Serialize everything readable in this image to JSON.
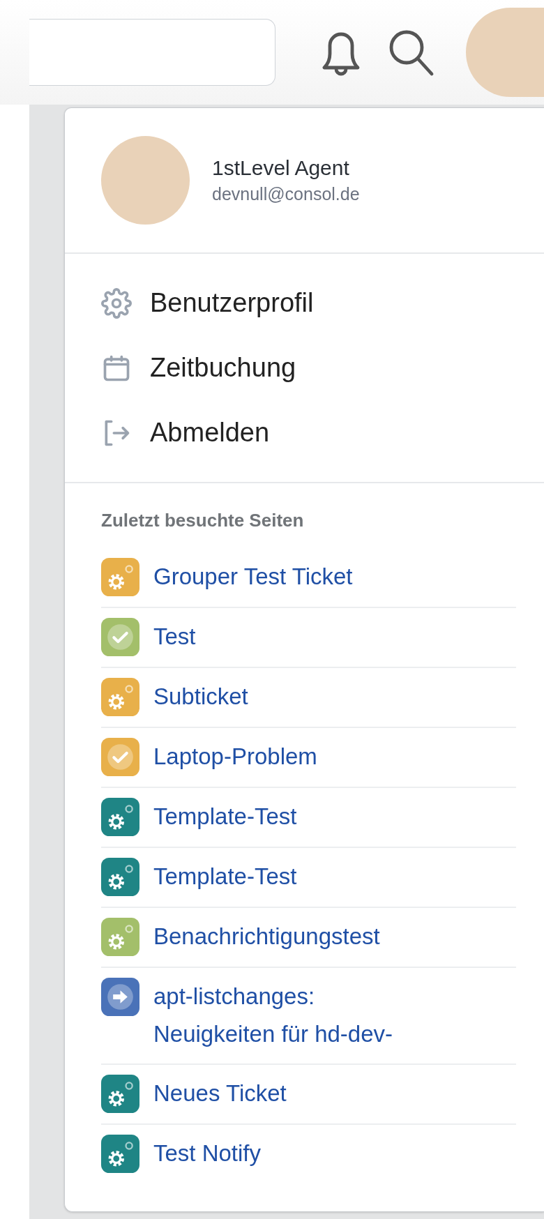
{
  "user": {
    "name": "1stLevel Agent",
    "email": "devnull@consol.de"
  },
  "menu": [
    {
      "label": "Benutzerprofil",
      "kind": "settings"
    },
    {
      "label": "Zeitbuchung",
      "kind": "calendar"
    },
    {
      "label": "Abmelden",
      "kind": "logout"
    }
  ],
  "recent": {
    "title": "Zuletzt besuchte Seiten",
    "items": [
      {
        "label": "Grouper Test Ticket",
        "kind": "gear",
        "color": "#e8b04a"
      },
      {
        "label": "Test",
        "kind": "check",
        "color": "#a3bf6a"
      },
      {
        "label": "Subticket",
        "kind": "gear",
        "color": "#e8b04a"
      },
      {
        "label": "Laptop-Problem",
        "kind": "check",
        "color": "#e8b04a"
      },
      {
        "label": "Template-Test",
        "kind": "gear",
        "color": "#1f8585"
      },
      {
        "label": "Template-Test",
        "kind": "gear",
        "color": "#1f8585"
      },
      {
        "label": "Benachrichtigungstest",
        "kind": "gear",
        "color": "#a3bf6a"
      },
      {
        "label": "apt-listchanges: Neuigkeiten für hd-dev-",
        "kind": "arrow",
        "color": "#4a72b8"
      },
      {
        "label": "Neues Ticket",
        "kind": "gear",
        "color": "#1f8585"
      },
      {
        "label": "Test Notify",
        "kind": "gear",
        "color": "#1f8585"
      }
    ]
  }
}
